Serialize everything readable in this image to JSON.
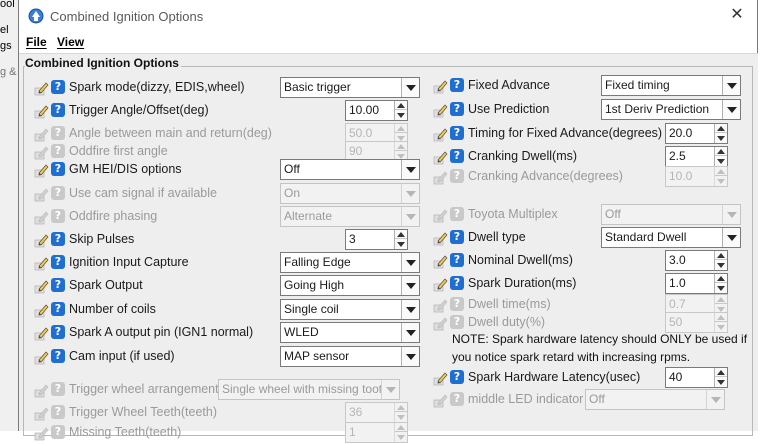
{
  "background_app": {
    "fragments": [
      "ool",
      "el",
      "gs",
      "g &"
    ]
  },
  "window": {
    "title": "Combined Ignition Options",
    "close_glyph": "✕"
  },
  "menu": {
    "file": "File",
    "view": "View"
  },
  "group": {
    "title": "Combined Ignition Options"
  },
  "left_rows": [
    {
      "label": "Spark mode(dizzy, EDIS,wheel)",
      "type": "combo",
      "value": "Basic trigger",
      "enabled": true
    },
    {
      "label": "Trigger Angle/Offset(deg)",
      "type": "spin",
      "value": "10.00",
      "enabled": true
    },
    {
      "label": "Angle between main and return(deg)",
      "type": "spin",
      "value": "50.0",
      "enabled": false
    },
    {
      "label": "Oddfire first angle",
      "type": "spin",
      "value": "90",
      "enabled": false
    },
    {
      "label": "GM HEI/DIS options",
      "type": "combo",
      "value": "Off",
      "enabled": true
    },
    {
      "label": "Use cam signal if available",
      "type": "combo",
      "value": "On",
      "enabled": false
    },
    {
      "label": "Oddfire phasing",
      "type": "combo",
      "value": "Alternate",
      "enabled": false
    },
    {
      "label": "Skip Pulses",
      "type": "spin",
      "value": "3",
      "enabled": true
    },
    {
      "label": "Ignition Input Capture",
      "type": "combo",
      "value": "Falling Edge",
      "enabled": true
    },
    {
      "label": "Spark Output",
      "type": "combo",
      "value": "Going High",
      "enabled": true
    },
    {
      "label": "Number of coils",
      "type": "combo",
      "value": "Single coil",
      "enabled": true
    },
    {
      "label": "Spark A output pin (IGN1 normal)",
      "type": "combo",
      "value": "WLED",
      "enabled": true
    },
    {
      "label": "Cam input (if used)",
      "type": "combo",
      "value": "MAP sensor",
      "enabled": true
    },
    {
      "label": "Trigger wheel arrangement",
      "type": "combo",
      "value": "Single wheel with missing tooth",
      "enabled": false
    },
    {
      "label": "Trigger Wheel Teeth(teeth)",
      "type": "spin",
      "value": "36",
      "enabled": false
    },
    {
      "label": "Missing Teeth(teeth)",
      "type": "spin",
      "value": "1",
      "enabled": false
    }
  ],
  "right_rows": [
    {
      "label": "Fixed Advance",
      "type": "combo",
      "value": "Fixed timing",
      "enabled": true
    },
    {
      "label": "Use Prediction",
      "type": "combo",
      "value": "1st Deriv Prediction",
      "enabled": true
    },
    {
      "label": "Timing for Fixed Advance(degrees)",
      "type": "spin",
      "value": "20.0",
      "enabled": true
    },
    {
      "label": "Cranking Dwell(ms)",
      "type": "spin",
      "value": "2.5",
      "enabled": true
    },
    {
      "label": "Cranking Advance(degrees)",
      "type": "spin",
      "value": "10.0",
      "enabled": false
    },
    {
      "label": "Toyota Multiplex",
      "type": "combo",
      "value": "Off",
      "enabled": false
    },
    {
      "label": "Dwell type",
      "type": "combo",
      "value": "Standard Dwell",
      "enabled": true
    },
    {
      "label": "Nominal Dwell(ms)",
      "type": "spin",
      "value": "3.0",
      "enabled": true
    },
    {
      "label": "Spark Duration(ms)",
      "type": "spin",
      "value": "1.0",
      "enabled": true
    },
    {
      "label": "Dwell time(ms)",
      "type": "spin",
      "value": "0.7",
      "enabled": false
    },
    {
      "label": "Dwell duty(%)",
      "type": "spin",
      "value": "50",
      "enabled": false
    },
    {
      "label": "Spark Hardware Latency(usec)",
      "type": "spin",
      "value": "40",
      "enabled": true
    },
    {
      "label": "middle LED indicator",
      "type": "combo",
      "value": "Off",
      "enabled": false
    }
  ],
  "note": {
    "line1": "NOTE: Spark hardware latency should ONLY be used if",
    "line2": "you notice spark retard with increasing rpms."
  },
  "help_glyph": "?"
}
